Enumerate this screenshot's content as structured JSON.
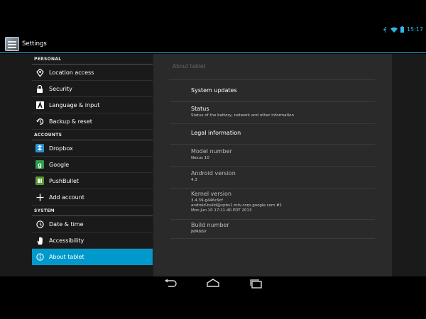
{
  "status_bar": {
    "time": "15:17"
  },
  "action_bar": {
    "title": "Settings"
  },
  "sidebar": {
    "sections": [
      {
        "header": "PERSONAL",
        "items": [
          {
            "label": "Location access",
            "icon": "location-icon"
          },
          {
            "label": "Security",
            "icon": "lock-icon"
          },
          {
            "label": "Language & input",
            "icon": "keyboard-icon"
          },
          {
            "label": "Backup & reset",
            "icon": "restore-icon"
          }
        ]
      },
      {
        "header": "ACCOUNTS",
        "items": [
          {
            "label": "Dropbox",
            "icon": "dropbox-icon"
          },
          {
            "label": "Google",
            "icon": "google-icon"
          },
          {
            "label": "PushBullet",
            "icon": "pushbullet-icon"
          },
          {
            "label": "Add account",
            "icon": "plus-icon"
          }
        ]
      },
      {
        "header": "SYSTEM",
        "items": [
          {
            "label": "Date & time",
            "icon": "clock-icon"
          },
          {
            "label": "Accessibility",
            "icon": "hand-icon"
          },
          {
            "label": "About tablet",
            "icon": "info-icon",
            "selected": true
          }
        ]
      }
    ]
  },
  "about": {
    "title": "About tablet",
    "items": [
      {
        "title": "System updates"
      },
      {
        "title": "Status",
        "summary": "Status of the battery, network and other information"
      },
      {
        "title": "Legal information"
      },
      {
        "title": "Model number",
        "summary": "Nexus 10"
      },
      {
        "title": "Android version",
        "summary": "4.3"
      },
      {
        "title": "Kernel version",
        "summary_lines": [
          "3.4.39-g446c9cf",
          "android-build@vpbs1.mtv.corp.google.com #1",
          "Mon Jun 10 17:11:40 PDT 2013"
        ]
      },
      {
        "title": "Build number",
        "summary": "JWR66V"
      }
    ]
  },
  "colors": {
    "accent": "#33b5e5",
    "selected": "#0099cc"
  }
}
